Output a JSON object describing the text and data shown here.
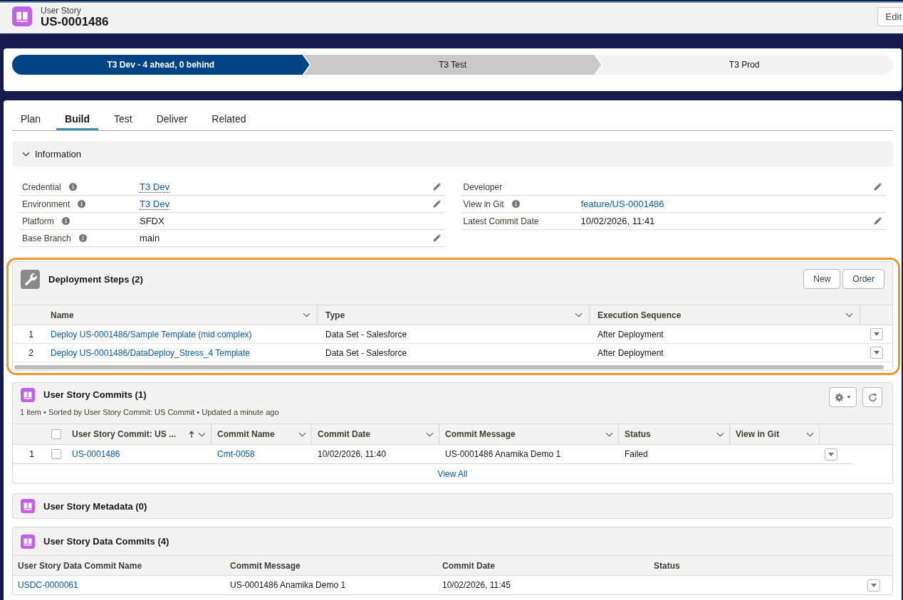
{
  "header": {
    "object_type": "User Story",
    "record_name": "US-0001486",
    "edit_button": "Edit"
  },
  "path": {
    "stages": [
      {
        "label": "T3 Dev - 4 ahead, 0 behind",
        "selected": true,
        "hovered": false
      },
      {
        "label": "T3 Test",
        "selected": false,
        "hovered": true
      },
      {
        "label": "T3 Prod",
        "selected": false,
        "hovered": false
      }
    ]
  },
  "tabs": [
    {
      "label": "Plan",
      "selected": false
    },
    {
      "label": "Build",
      "selected": true
    },
    {
      "label": "Test",
      "selected": false
    },
    {
      "label": "Deliver",
      "selected": false
    },
    {
      "label": "Related",
      "selected": false
    }
  ],
  "information": {
    "title": "Information",
    "expanded": true,
    "left_fields": [
      {
        "label": "Credential",
        "info": true,
        "value": "T3 Dev",
        "kind": "lookup",
        "editable": true
      },
      {
        "label": "Environment",
        "info": true,
        "value": "T3 Dev",
        "kind": "lookup",
        "editable": true
      },
      {
        "label": "Platform",
        "info": true,
        "value": "SFDX",
        "kind": "text",
        "editable": false
      },
      {
        "label": "Base Branch",
        "info": true,
        "value": "main",
        "kind": "text",
        "editable": true
      }
    ],
    "right_fields": [
      {
        "label": "Developer",
        "info": false,
        "editable": true
      },
      {
        "label": "View in Git",
        "info": true,
        "value": "feature/US-0001486",
        "kind": "link",
        "editable": false
      },
      {
        "label": "Latest Commit Date",
        "info": false,
        "value": "10/02/2026, 11:41",
        "kind": "text",
        "editable": true
      }
    ]
  },
  "deployment_steps": {
    "title": "Deployment Steps (2)",
    "highlighted": true,
    "buttons": [
      "New",
      "Order"
    ],
    "columns": [
      "Name",
      "Type",
      "Execution Sequence"
    ],
    "rows": [
      {
        "number": "1",
        "name": "Deploy US-0001486/Sample Template (mid complex)",
        "type": "Data Set - Salesforce",
        "execution_sequence": "After Deployment"
      },
      {
        "number": "2",
        "name": "Deploy US-0001486/DataDeploy_Stress_4 Template",
        "type": "Data Set - Salesforce",
        "execution_sequence": "After Deployment"
      }
    ]
  },
  "commits": {
    "title": "User Story Commits (1)",
    "summary": "1 item • Sorted by User Story Commit: US Commit • Updated a minute ago",
    "all_selected": false,
    "columns": [
      {
        "label": "User Story Commit: US ...",
        "sorted": true
      },
      {
        "label": "Commit Name",
        "sorted": false
      },
      {
        "label": "Commit Date",
        "sorted": false
      },
      {
        "label": "Commit Message",
        "sorted": false
      },
      {
        "label": "Status",
        "sorted": false
      },
      {
        "label": "View in Git",
        "sorted": false
      }
    ],
    "rows": [
      {
        "number": "1",
        "selected": false,
        "cells": [
          {
            "text": "US-0001486",
            "kind": "link"
          },
          {
            "text": "Cmt-0058",
            "kind": "link"
          },
          {
            "text": "10/02/2026, 11:40",
            "kind": "text"
          },
          {
            "text": "US-0001486 Anamika Demo 1",
            "kind": "text"
          },
          {
            "text": "Failed",
            "kind": "text"
          }
        ]
      }
    ],
    "footer_link": "View All"
  },
  "metadata": {
    "title": "User Story Metadata (0)"
  },
  "data_commits": {
    "title": "User Story Data Commits (4)",
    "columns": [
      "User Story Data Commit Name",
      "Commit Message",
      "Commit Date",
      "Status"
    ],
    "rows": [
      {
        "cells": [
          {
            "text": "USDC-0000061",
            "kind": "link"
          },
          {
            "text": "US-0001486 Anamika Demo 1",
            "kind": "text"
          },
          {
            "text": "10/02/2026, 11:45",
            "kind": "text"
          }
        ]
      }
    ]
  }
}
